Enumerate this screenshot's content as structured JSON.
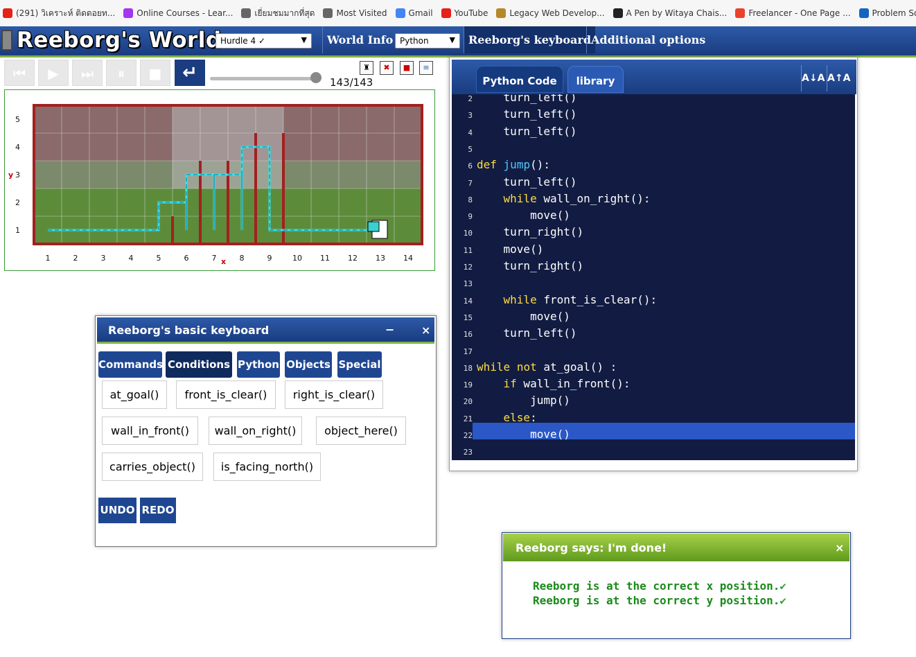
{
  "bookmarks": [
    {
      "label": "(291) วิเคราะห์ ติดดอยท...",
      "icon": "youtube-icon",
      "color": "#e62117"
    },
    {
      "label": "Online Courses - Lear...",
      "icon": "udemy-icon",
      "color": "#a435f0"
    },
    {
      "label": "เยี่ยมชมมากที่สุด",
      "icon": "gear-icon",
      "color": "#666666"
    },
    {
      "label": "Most Visited",
      "icon": "gear-icon",
      "color": "#666666"
    },
    {
      "label": "Gmail",
      "icon": "google-icon",
      "color": "#4285f4"
    },
    {
      "label": "YouTube",
      "icon": "youtube-icon",
      "color": "#e62117"
    },
    {
      "label": "Legacy Web Develop...",
      "icon": "freecodecamp-icon",
      "color": "#b5882a"
    },
    {
      "label": "A Pen by Witaya Chais...",
      "icon": "codepen-icon",
      "color": "#222222"
    },
    {
      "label": "Freelancer - One Page ...",
      "icon": "freelancer-icon",
      "color": "#e8432a"
    },
    {
      "label": "Problem Solving, Pyth...",
      "icon": "c-icon",
      "color": "#1565c0"
    }
  ],
  "topbar": {
    "logo": "Reeborg's World",
    "world_select": "Hurdle 4 ✓",
    "world_info": "World Info",
    "language_select": "Python",
    "keyboard": "Reeborg's keyboard",
    "options": "Additional options"
  },
  "controls": {
    "step_count": "143/143",
    "progress": 1.0
  },
  "world": {
    "y_label": "y",
    "x_label": "x",
    "x_ticks": [
      "1",
      "2",
      "3",
      "4",
      "5",
      "6",
      "7",
      "8",
      "9",
      "10",
      "11",
      "12",
      "13",
      "14"
    ],
    "y_ticks": [
      "1",
      "2",
      "3",
      "4",
      "5"
    ]
  },
  "editor": {
    "tab_code": "Python Code",
    "tab_library": "library",
    "font_down": "A↓A",
    "font_up": "A↑A",
    "lines": [
      {
        "n": "2",
        "text": "    turn_left()"
      },
      {
        "n": "3",
        "text": "    turn_left()"
      },
      {
        "n": "4",
        "text": "    turn_left()"
      },
      {
        "n": "5",
        "text": ""
      },
      {
        "n": "6",
        "text": "def jump():"
      },
      {
        "n": "7",
        "text": "    turn_left()"
      },
      {
        "n": "8",
        "text": "    while wall_on_right():"
      },
      {
        "n": "9",
        "text": "        move()"
      },
      {
        "n": "10",
        "text": "    turn_right()"
      },
      {
        "n": "11",
        "text": "    move()"
      },
      {
        "n": "12",
        "text": "    turn_right()"
      },
      {
        "n": "13",
        "text": ""
      },
      {
        "n": "14",
        "text": "    while front_is_clear():"
      },
      {
        "n": "15",
        "text": "        move()"
      },
      {
        "n": "16",
        "text": "    turn_left()"
      },
      {
        "n": "17",
        "text": ""
      },
      {
        "n": "18",
        "text": "while not at_goal() :"
      },
      {
        "n": "19",
        "text": "    if wall_in_front():"
      },
      {
        "n": "20",
        "text": "        jump()"
      },
      {
        "n": "21",
        "text": "    else:"
      },
      {
        "n": "22",
        "text": "        move()"
      },
      {
        "n": "23",
        "text": ""
      }
    ]
  },
  "keyboard": {
    "title": "Reeborg's basic keyboard",
    "minimize": "−",
    "close": "×",
    "tabs": [
      "Commands",
      "Conditions",
      "Python",
      "Objects",
      "Special"
    ],
    "active_tab": "Conditions",
    "buttons": [
      "at_goal()",
      "front_is_clear()",
      "right_is_clear()",
      "wall_in_front()",
      "wall_on_right()",
      "object_here()",
      "carries_object()",
      "is_facing_north()"
    ],
    "undo": "UNDO",
    "redo": "REDO"
  },
  "says": {
    "title": "Reeborg says: I'm done!",
    "close": "×",
    "line1": "Reeborg is at the correct x position.",
    "line2": "Reeborg is at the correct y position."
  },
  "colors": {
    "header_blue": "#1a3c80",
    "accent_green": "#7fb24a",
    "code_bg": "#121c42",
    "keyword": "#ffdd44",
    "function": "#4dc9ff",
    "wall": "#a32020",
    "path": "#33e5e5",
    "success": "#1a8a1a"
  }
}
